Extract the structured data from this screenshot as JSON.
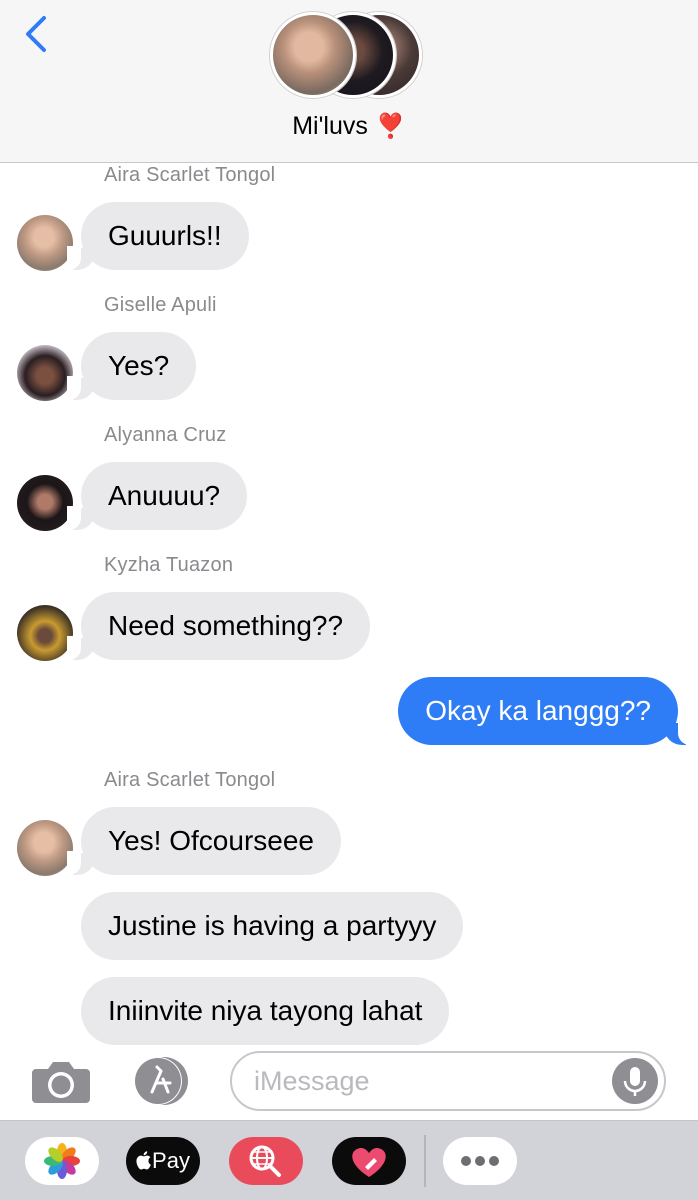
{
  "header": {
    "back_icon": "chevron-left-icon",
    "group_name": "Mi'luvs",
    "group_emoji": "❣️",
    "group_avatars": [
      "#c9a08a",
      "#3a2b30",
      "#5a4a48"
    ]
  },
  "messages": [
    {
      "sender": "Aira Scarlet Tongol",
      "text": "Guuurls!!",
      "direction": "incoming"
    },
    {
      "sender": "Giselle Apuli",
      "text": "Yes?",
      "direction": "incoming"
    },
    {
      "sender": "Alyanna Cruz",
      "text": "Anuuuu?",
      "direction": "incoming"
    },
    {
      "sender": "Kyzha Tuazon",
      "text": "Need something??",
      "direction": "incoming"
    },
    {
      "sender": "",
      "text": "Okay ka langgg??",
      "direction": "outgoing"
    },
    {
      "sender": "Aira Scarlet Tongol",
      "text": "Yes! Ofcourseee",
      "direction": "incoming"
    },
    {
      "sender": "Aira Scarlet Tongol",
      "text": "Justine is having a partyyy",
      "direction": "incoming"
    },
    {
      "sender": "Aira Scarlet Tongol",
      "text": "Iniinvite niya tayong lahat",
      "direction": "incoming"
    }
  ],
  "input": {
    "placeholder": "iMessage",
    "camera_icon": "camera-icon",
    "appstore_icon": "app-store-icon",
    "mic_icon": "microphone-icon"
  },
  "drawer": {
    "apps": [
      {
        "name": "photos",
        "icon": "photos-icon"
      },
      {
        "name": "apple-pay",
        "label": "Pay",
        "icon": "apple-logo-icon"
      },
      {
        "name": "images-search",
        "icon": "globe-search-icon"
      },
      {
        "name": "digital-touch",
        "icon": "heart-touch-icon"
      },
      {
        "name": "more",
        "icon": "more-dots-icon"
      }
    ]
  },
  "colors": {
    "incoming_bubble": "#e9e9eb",
    "outgoing_bubble": "#2e7cf6",
    "accent": "#2f7cf6",
    "header_bg": "#f6f6f6",
    "drawer_bg": "#d1d3d9"
  }
}
